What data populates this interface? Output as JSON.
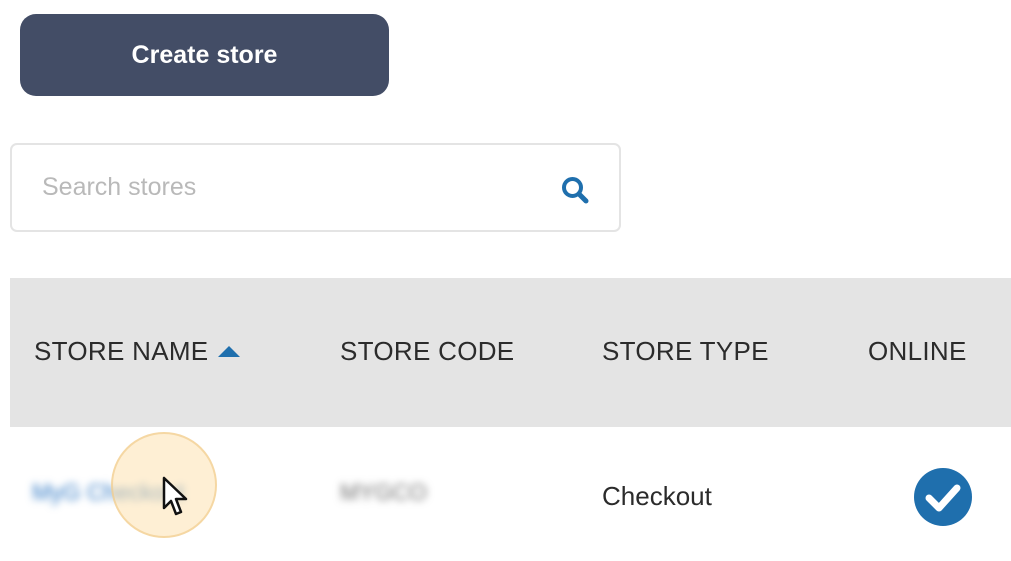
{
  "toolbar": {
    "create_label": "Create store"
  },
  "search": {
    "placeholder": "Search stores",
    "value": "",
    "icon": "search-icon"
  },
  "table": {
    "columns": [
      {
        "label": "STORE NAME",
        "sorted": "ascending"
      },
      {
        "label": "STORE CODE"
      },
      {
        "label": "STORE TYPE"
      },
      {
        "label": "ONLINE"
      }
    ],
    "rows": [
      {
        "store_name": "MyG Checkout",
        "store_code": "MYGCO",
        "store_type": "Checkout",
        "online": true,
        "online_icon": "check-circle-icon"
      }
    ]
  },
  "colors": {
    "primary_button": "#434d66",
    "accent_blue": "#1f6fad",
    "header_bg": "#e4e4e4",
    "cursor_highlight": "#fde1b0"
  }
}
